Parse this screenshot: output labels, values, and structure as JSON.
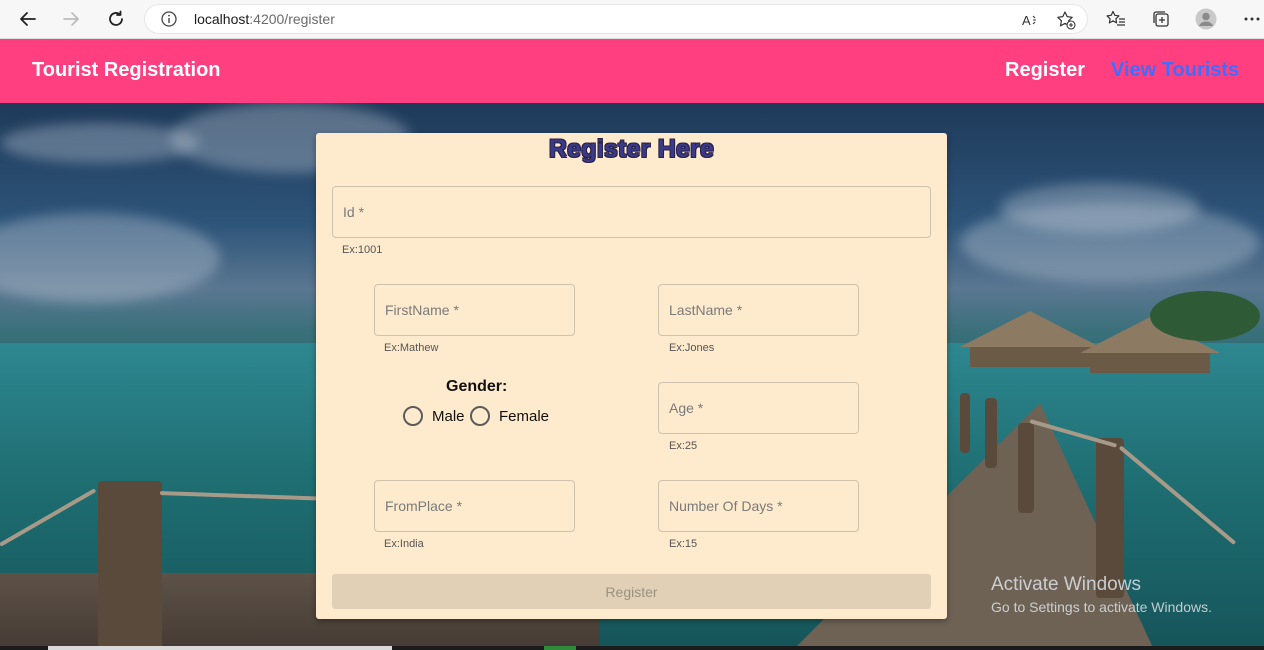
{
  "browser": {
    "url_host": "localhost",
    "url_path": ":4200/register",
    "icons": [
      "back-icon",
      "forward-icon",
      "refresh-icon",
      "info-icon",
      "read-aloud-icon",
      "add-favorite-icon",
      "favorites-icon",
      "collections-icon",
      "profile-icon",
      "more-icon"
    ]
  },
  "toolbar": {
    "brand": "Tourist Registration",
    "nav_register": "Register",
    "nav_view_tourists": "View Tourists",
    "bg_color": "#ff3f7f",
    "view_link_color": "#3f6dff"
  },
  "form": {
    "title": "Register Here",
    "id": {
      "placeholder": "Id *",
      "hint": "Ex:1001"
    },
    "first_name": {
      "placeholder": "FirstName *",
      "hint": "Ex:Mathew"
    },
    "last_name": {
      "placeholder": "LastName *",
      "hint": "Ex:Jones"
    },
    "gender": {
      "label": "Gender:",
      "options": [
        "Male",
        "Female"
      ]
    },
    "age": {
      "placeholder": "Age *",
      "hint": "Ex:25"
    },
    "from_place": {
      "placeholder": "FromPlace *",
      "hint": "Ex:India"
    },
    "num_days": {
      "placeholder": "Number Of Days *",
      "hint": "Ex:15"
    },
    "submit_label": "Register",
    "card_color": "#feebcd"
  },
  "watermark": {
    "title": "Activate Windows",
    "subtitle": "Go to Settings to activate Windows."
  }
}
